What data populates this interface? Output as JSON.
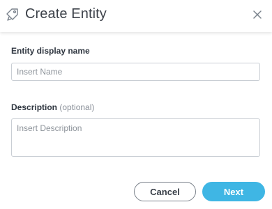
{
  "dialog": {
    "title": "Create Entity",
    "close_icon": "close-icon",
    "entity_icon": "tag-icon"
  },
  "form": {
    "name_label": "Entity display name",
    "name_placeholder": "Insert Name",
    "name_value": "",
    "description_label": "Description",
    "description_optional": "(optional)",
    "description_placeholder": "Insert Description",
    "description_value": ""
  },
  "actions": {
    "cancel_label": "Cancel",
    "next_label": "Next"
  },
  "colors": {
    "accent": "#3fb6e4",
    "border": "#c9ced4",
    "text": "#333a44",
    "muted": "#8a9099"
  }
}
